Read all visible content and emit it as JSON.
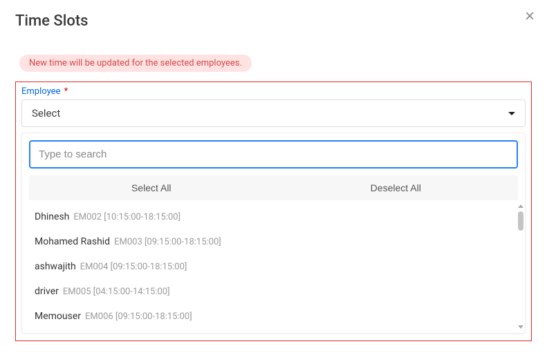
{
  "modal": {
    "title": "Time Slots",
    "infoBanner": "New time will be updated for the selected employees.",
    "closeLabel": "×"
  },
  "form": {
    "employeeLabel": "Employee",
    "required": "*",
    "selectPlaceholder": "Select",
    "searchPlaceholder": "Type to search",
    "selectAllLabel": "Select All",
    "deselectAllLabel": "Deselect All"
  },
  "options": [
    {
      "name": "Dhinesh",
      "meta": "EM002 [10:15:00-18:15:00]"
    },
    {
      "name": "Mohamed Rashid",
      "meta": "EM003 [09:15:00-18:15:00]"
    },
    {
      "name": "ashwajith",
      "meta": "EM004 [09:15:00-18:15:00]"
    },
    {
      "name": "driver",
      "meta": "EM005 [04:15:00-14:15:00]"
    },
    {
      "name": "Memouser",
      "meta": "EM006 [09:15:00-18:15:00]"
    }
  ]
}
